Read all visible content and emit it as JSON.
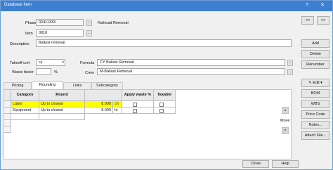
{
  "window": {
    "title": "Database Item",
    "help_label": "?",
    "close_label": "✕"
  },
  "form": {
    "phase_label": "Phase",
    "phase_value": "02411333",
    "phase_btn": "...",
    "phase_desc": "Railroad Removal",
    "item_label": "Item",
    "item_value": "0010",
    "item_btn": "...",
    "description_label": "Description",
    "description_value": "Ballast removal",
    "takeoff_unit_label": "Takeoff unit",
    "takeoff_unit_value": "cy",
    "waste_factor_label": "Waste factor",
    "waste_factor_value": "",
    "waste_unit": "%",
    "formula_label": "Formula",
    "formula_value": "CY Ballast Removal",
    "formula_btn": "...",
    "crew_label": "Crew",
    "crew_value": "M-Ballast Removal",
    "crew_btn": "..."
  },
  "right_panel": {
    "nav_prev": "<<",
    "nav_next": ">>",
    "buttons": [
      "Add",
      "Delete",
      "Renumber"
    ],
    "edit_label": "Edit",
    "buttons2": [
      "BOM",
      "WBS",
      "Price Code",
      "Notes...",
      "Attach File..."
    ]
  },
  "tabs": [
    "Pricing",
    "Rounding",
    "Links",
    "Subcategory"
  ],
  "grid": {
    "headers": [
      "Category",
      "Round",
      "",
      "Apply waste %",
      "Taxable"
    ],
    "rows": [
      {
        "category": "Labor",
        "round": "Up to closest",
        "value": "8.000",
        "unit": "ch"
      },
      {
        "category": "Equipment",
        "round": "Up to closest",
        "value": "8.000",
        "unit": "hr"
      }
    ]
  },
  "move": {
    "label": "Move",
    "up": "▲",
    "down": "▼"
  },
  "footer": {
    "close": "Close",
    "help": "Help"
  },
  "colors": {
    "highlight": "#ffff00",
    "titlebar": "#3d7fd0"
  }
}
